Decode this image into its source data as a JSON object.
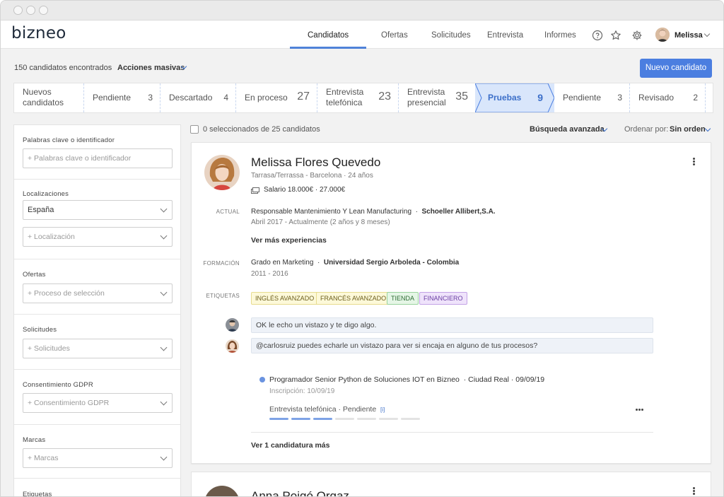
{
  "brand": {
    "logo": "bizneo",
    "accent": "#4b7ee0"
  },
  "nav": {
    "items": [
      "Candidatos",
      "Ofertas",
      "Solicitudes",
      "Entrevista",
      "Informes"
    ],
    "active": "Candidatos",
    "user": "Melissa",
    "icons": [
      "help-icon",
      "star-icon",
      "gear-icon"
    ]
  },
  "toolbar": {
    "count_text": "150 candidatos encontrados",
    "bulk_actions": "Acciones masivas",
    "new_button": "Nuevo candidato"
  },
  "pipeline": {
    "stages": [
      {
        "label": "Nuevos candidatos",
        "count": ""
      },
      {
        "label": "Pendiente",
        "count": "3"
      },
      {
        "label": "Descartado",
        "count": "4"
      },
      {
        "label": "En proceso",
        "count": "27"
      },
      {
        "label": "Entrevista telefónica",
        "count": "23"
      },
      {
        "label": "Entrevista presencial",
        "count": "35"
      },
      {
        "label": "Pruebas",
        "count": "9"
      },
      {
        "label": "Pendiente",
        "count": "3"
      },
      {
        "label": "Revisado",
        "count": "2"
      }
    ],
    "active_index": 6
  },
  "filters": {
    "keywords_label": "Palabras clave o identificador",
    "keywords_placeholder": "+ Palabras clave o identificador",
    "locations_label": "Localizaciones",
    "location_value": "España",
    "location_placeholder": "+ Localización",
    "offers_label": "Ofertas",
    "offers_placeholder": "+ Proceso de selección",
    "requests_label": "Solicitudes",
    "requests_placeholder": "+ Solicitudes",
    "gdpr_label": "Consentimiento GDPR",
    "gdpr_placeholder": "+ Consentimiento GDPR",
    "brands_label": "Marcas",
    "brands_placeholder": "+ Marcas",
    "tags_label": "Etiquetas"
  },
  "list": {
    "selected_text": "0 seleccionados de 25 candidatos",
    "advanced_search": "Búsqueda avanzada",
    "sort_label": "Ordenar por:",
    "sort_value": "Sin orden"
  },
  "candidate": {
    "name": "Melissa Flores Quevedo",
    "location": "Tarrasa/Terrassa - Barcelona · 24 años",
    "salary": "Salario 18.000€ · 27.000€",
    "current_label": "ACTUAL",
    "job_title": "Responsable Mantenimiento Y Lean Manufacturing",
    "company": "Schoeller Allibert,S.A.",
    "job_dates": "Abril 2017 - Actualmente (2 años y 8 meses)",
    "more_experience": "Ver más experiencias",
    "education_label": "FORMACIÓN",
    "degree": "Grado en Marketing",
    "university": "Universidad Sergio Arboleda - Colombia",
    "edu_years": "2011 - 2016",
    "tags_label": "ETIQUETAS",
    "tags": [
      {
        "text": "INGLÉS AVANZADO",
        "bg": "#fdf9d9",
        "border": "#e7dc8f",
        "color": "#6b5d1a"
      },
      {
        "text": "FRANCÉS AVANZADO",
        "bg": "#fdf9d9",
        "border": "#e7dc8f",
        "color": "#6b5d1a"
      },
      {
        "text": "TIENDA",
        "bg": "#e5f6e6",
        "border": "#9ad39e",
        "color": "#2f6d35"
      },
      {
        "text": "FINANCIERO",
        "bg": "#efe3fb",
        "border": "#c3a2e6",
        "color": "#6a3ea3"
      }
    ],
    "comments": [
      "OK le echo un vistazo y te digo algo.",
      "@carlosruiz puedes echarle un vistazo para ver si encaja en alguno de tus procesos?"
    ],
    "application": {
      "title": "Programador Senior Python de Soluciones IOT en Bizneo",
      "place_date": "· Ciudad Real · 09/09/19",
      "inscription": "Inscripción: 10/09/19",
      "stage": "Entrevista telefónica · Pendiente",
      "stage_badge": "[i]",
      "progress_done": 3,
      "progress_total": 7
    },
    "more_applications": "Ver 1 candidatura más"
  },
  "candidate2": {
    "name": "Anna Poigó Orgaz"
  }
}
